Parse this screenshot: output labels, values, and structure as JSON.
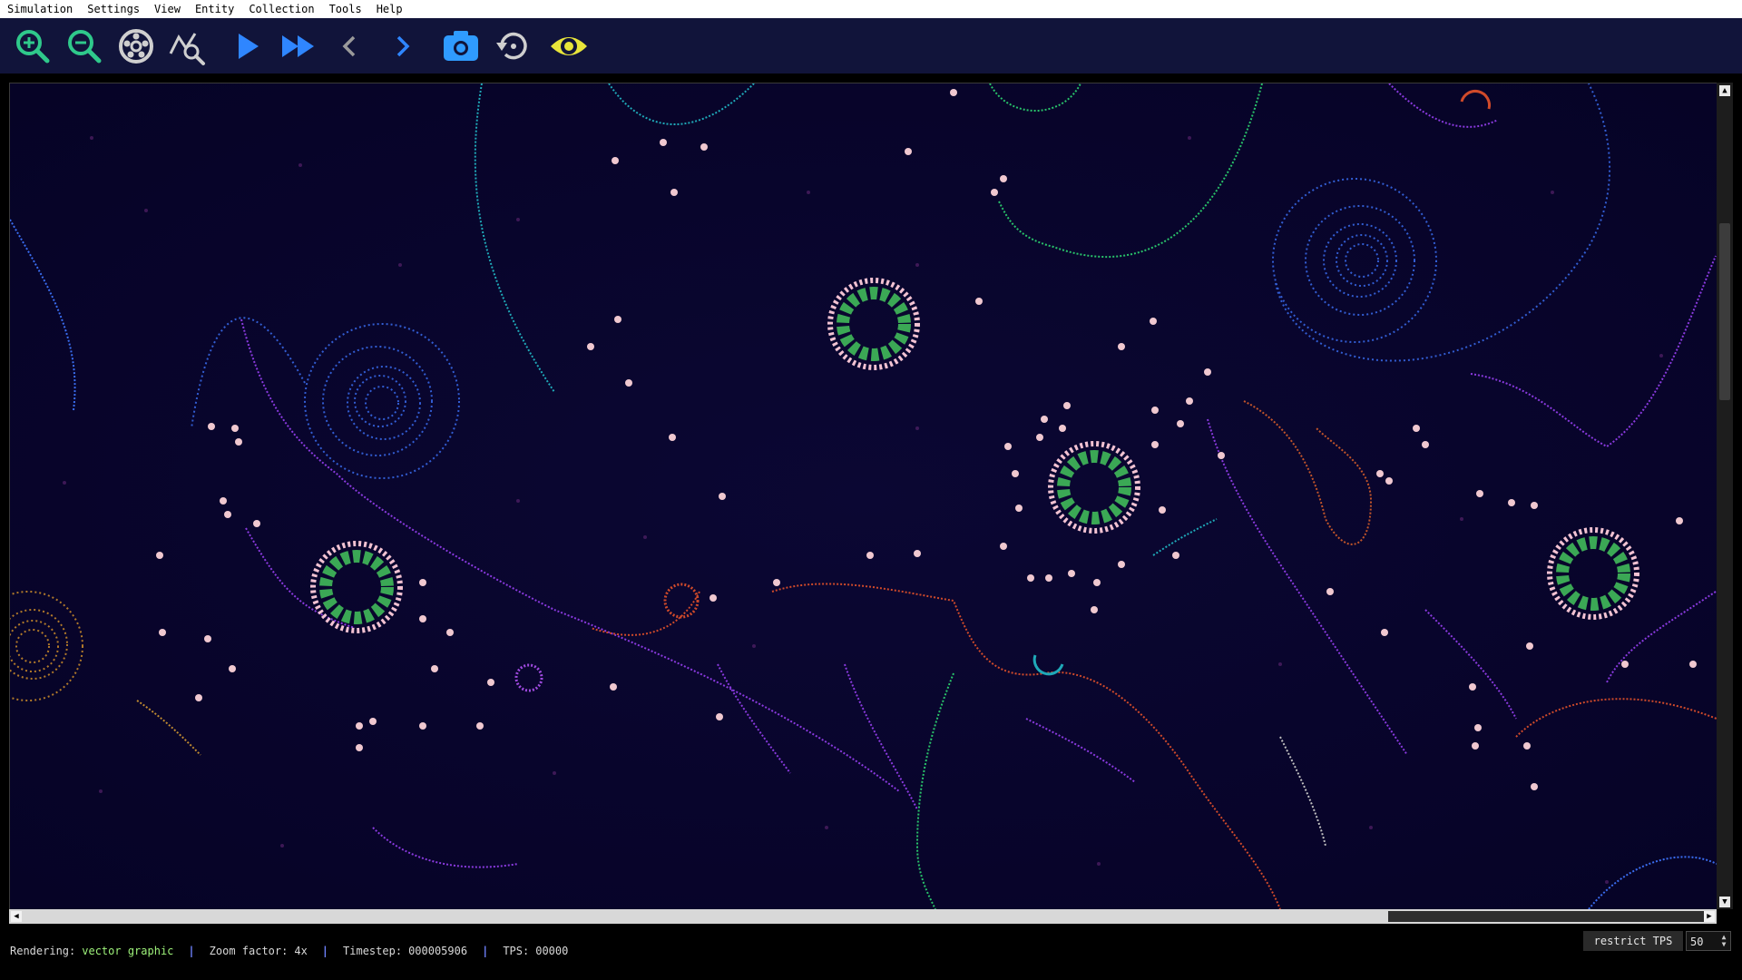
{
  "menu": [
    "Simulation",
    "Settings",
    "View",
    "Entity",
    "Collection",
    "Tools",
    "Help"
  ],
  "toolbar": {
    "buttons": [
      {
        "name": "zoom-in-button",
        "icon": "zoom-in-icon",
        "color": "#2fc98b"
      },
      {
        "name": "zoom-out-button",
        "icon": "zoom-out-icon",
        "color": "#2fc98b"
      },
      {
        "name": "auto-zoom-button",
        "icon": "wheel-icon",
        "color": "#cfcfcf"
      },
      {
        "name": "search-pattern-button",
        "icon": "search-chart-icon",
        "color": "#cfcfcf"
      },
      {
        "name": "run-button",
        "icon": "play-icon",
        "color": "#2f86ff"
      },
      {
        "name": "fast-forward-button",
        "icon": "fast-forward-icon",
        "color": "#2f86ff"
      },
      {
        "name": "step-back-button",
        "icon": "chevron-left-icon",
        "color": "#9a9a9a"
      },
      {
        "name": "step-forward-button",
        "icon": "chevron-right-icon",
        "color": "#2f86ff"
      },
      {
        "name": "snapshot-button",
        "icon": "camera-icon",
        "color": "#2f9bff"
      },
      {
        "name": "restore-button",
        "icon": "restore-icon",
        "color": "#cfcfcf"
      },
      {
        "name": "rendering-toggle-button",
        "icon": "eye-icon",
        "color": "#e8e53a"
      }
    ]
  },
  "status": {
    "rendering_label": "Rendering:",
    "rendering_value": "vector graphic",
    "zoom_label": "Zoom factor:",
    "zoom_value": "4x",
    "timestep_label": "Timestep:",
    "timestep_value": "000005906",
    "tps_label": "TPS:",
    "tps_value": "00000",
    "separator": "|"
  },
  "restrict_tps": {
    "label": "restrict TPS",
    "value": "50"
  },
  "scroll": {
    "up": "▲",
    "down": "▼",
    "left": "◀",
    "right": "▶",
    "spin_up": "▲",
    "spin_down": "▼"
  },
  "colors": {
    "background": "#07042a",
    "toolbar": "#11143a",
    "ring_green": "#3ba855",
    "ring_pink": "#f2c2d2",
    "accent_blue": "#2f86ff"
  }
}
